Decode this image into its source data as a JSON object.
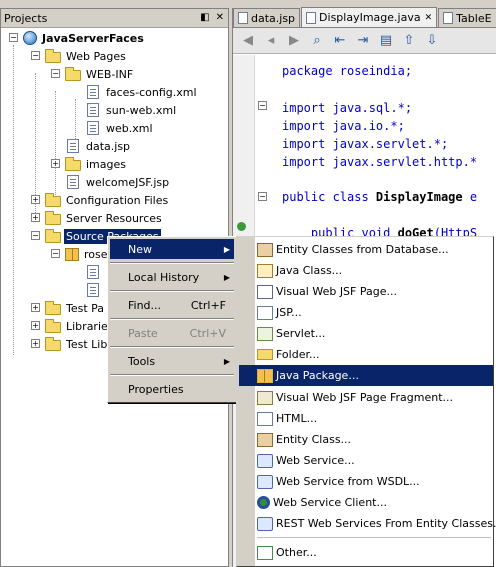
{
  "projects_panel": {
    "title": "Projects",
    "tree": [
      {
        "label": "JavaServerFaces"
      },
      {
        "label": "Web Pages"
      },
      {
        "label": "WEB-INF"
      },
      {
        "label": "faces-config.xml"
      },
      {
        "label": "sun-web.xml"
      },
      {
        "label": "web.xml"
      },
      {
        "label": "data.jsp"
      },
      {
        "label": "images"
      },
      {
        "label": "welcomeJSF.jsp"
      },
      {
        "label": "Configuration Files"
      },
      {
        "label": "Server Resources"
      },
      {
        "label": "Source Packages"
      },
      {
        "label": "rose"
      },
      {
        "label": "Test Pa"
      },
      {
        "label": "Libraries"
      },
      {
        "label": "Test Lib"
      }
    ]
  },
  "editor": {
    "tabs": [
      {
        "label": "data.jsp"
      },
      {
        "label": "DisplayImage.java"
      },
      {
        "label": "TableE"
      }
    ],
    "code_lines": [
      {
        "text": "package roseindia;"
      },
      {
        "text": "import java.sql.*;"
      },
      {
        "text": "import java.io.*;"
      },
      {
        "text": "import javax.servlet.*;"
      },
      {
        "text": "import javax.servlet.http.*"
      },
      {
        "kw": "public class ",
        "name": "DisplayImage",
        "rest": " e"
      },
      {
        "kw": "    public void ",
        "name": "doGet",
        "rest": "(HttpS"
      }
    ]
  },
  "context_menu": {
    "items": [
      {
        "label": "New",
        "shortcut": ""
      },
      {
        "label": "Local History",
        "shortcut": ""
      },
      {
        "label": "Find...",
        "shortcut": "Ctrl+F"
      },
      {
        "label": "Paste",
        "shortcut": "Ctrl+V"
      },
      {
        "label": "Tools",
        "shortcut": ""
      },
      {
        "label": "Properties",
        "shortcut": ""
      }
    ]
  },
  "new_submenu": {
    "items": [
      {
        "label": "Entity Classes from Database...",
        "icon": "entity-classes-icon"
      },
      {
        "label": "Java Class...",
        "icon": "java-class-icon"
      },
      {
        "label": "Visual Web JSF Page...",
        "icon": "visual-web-page-icon"
      },
      {
        "label": "JSP...",
        "icon": "jsp-file-icon"
      },
      {
        "label": "Servlet...",
        "icon": "servlet-icon"
      },
      {
        "label": "Folder...",
        "icon": "folder-icon"
      },
      {
        "label": "Java Package...",
        "icon": "java-package-icon"
      },
      {
        "label": "Visual Web JSF Page Fragment...",
        "icon": "page-fragment-icon"
      },
      {
        "label": "HTML...",
        "icon": "html-file-icon"
      },
      {
        "label": "Entity Class...",
        "icon": "entity-class-icon"
      },
      {
        "label": "Web Service...",
        "icon": "web-service-icon"
      },
      {
        "label": "Web Service from WSDL...",
        "icon": "wsdl-icon"
      },
      {
        "label": "Web Service Client...",
        "icon": "web-service-client-icon"
      },
      {
        "label": "REST Web Services From Entity Classes...",
        "icon": "rest-service-icon"
      },
      {
        "label": "Other...",
        "icon": "other-file-icon"
      }
    ]
  },
  "colors": {
    "selection": "#0a246a",
    "window_bg": "#d4d0c8",
    "keyword": "#0000cc"
  }
}
